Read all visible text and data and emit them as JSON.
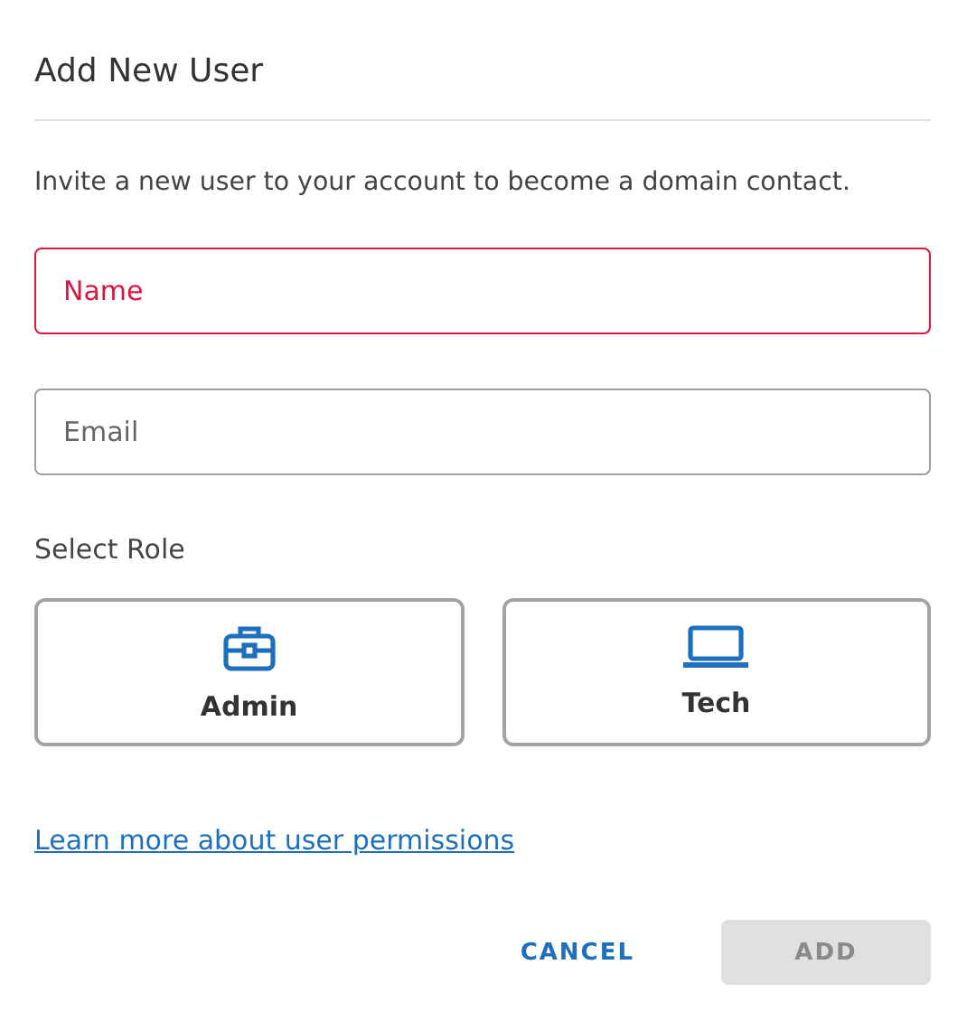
{
  "dialog": {
    "title": "Add New User",
    "description": "Invite a new user to your account to become a domain contact."
  },
  "fields": [
    {
      "placeholder": "Name",
      "error": true
    },
    {
      "placeholder": "Email",
      "error": false
    }
  ],
  "role_label": "Select Role",
  "roles": [
    {
      "kind": "briefcase",
      "label": "Admin",
      "selected": false
    },
    {
      "kind": "laptop",
      "label": "Tech",
      "selected": false
    }
  ],
  "link": "Learn more about user permissions",
  "buttons": [
    {
      "label": "CANCEL",
      "kind": "text",
      "disabled": false
    },
    {
      "label": "ADD",
      "kind": "filled",
      "disabled": true
    }
  ]
}
